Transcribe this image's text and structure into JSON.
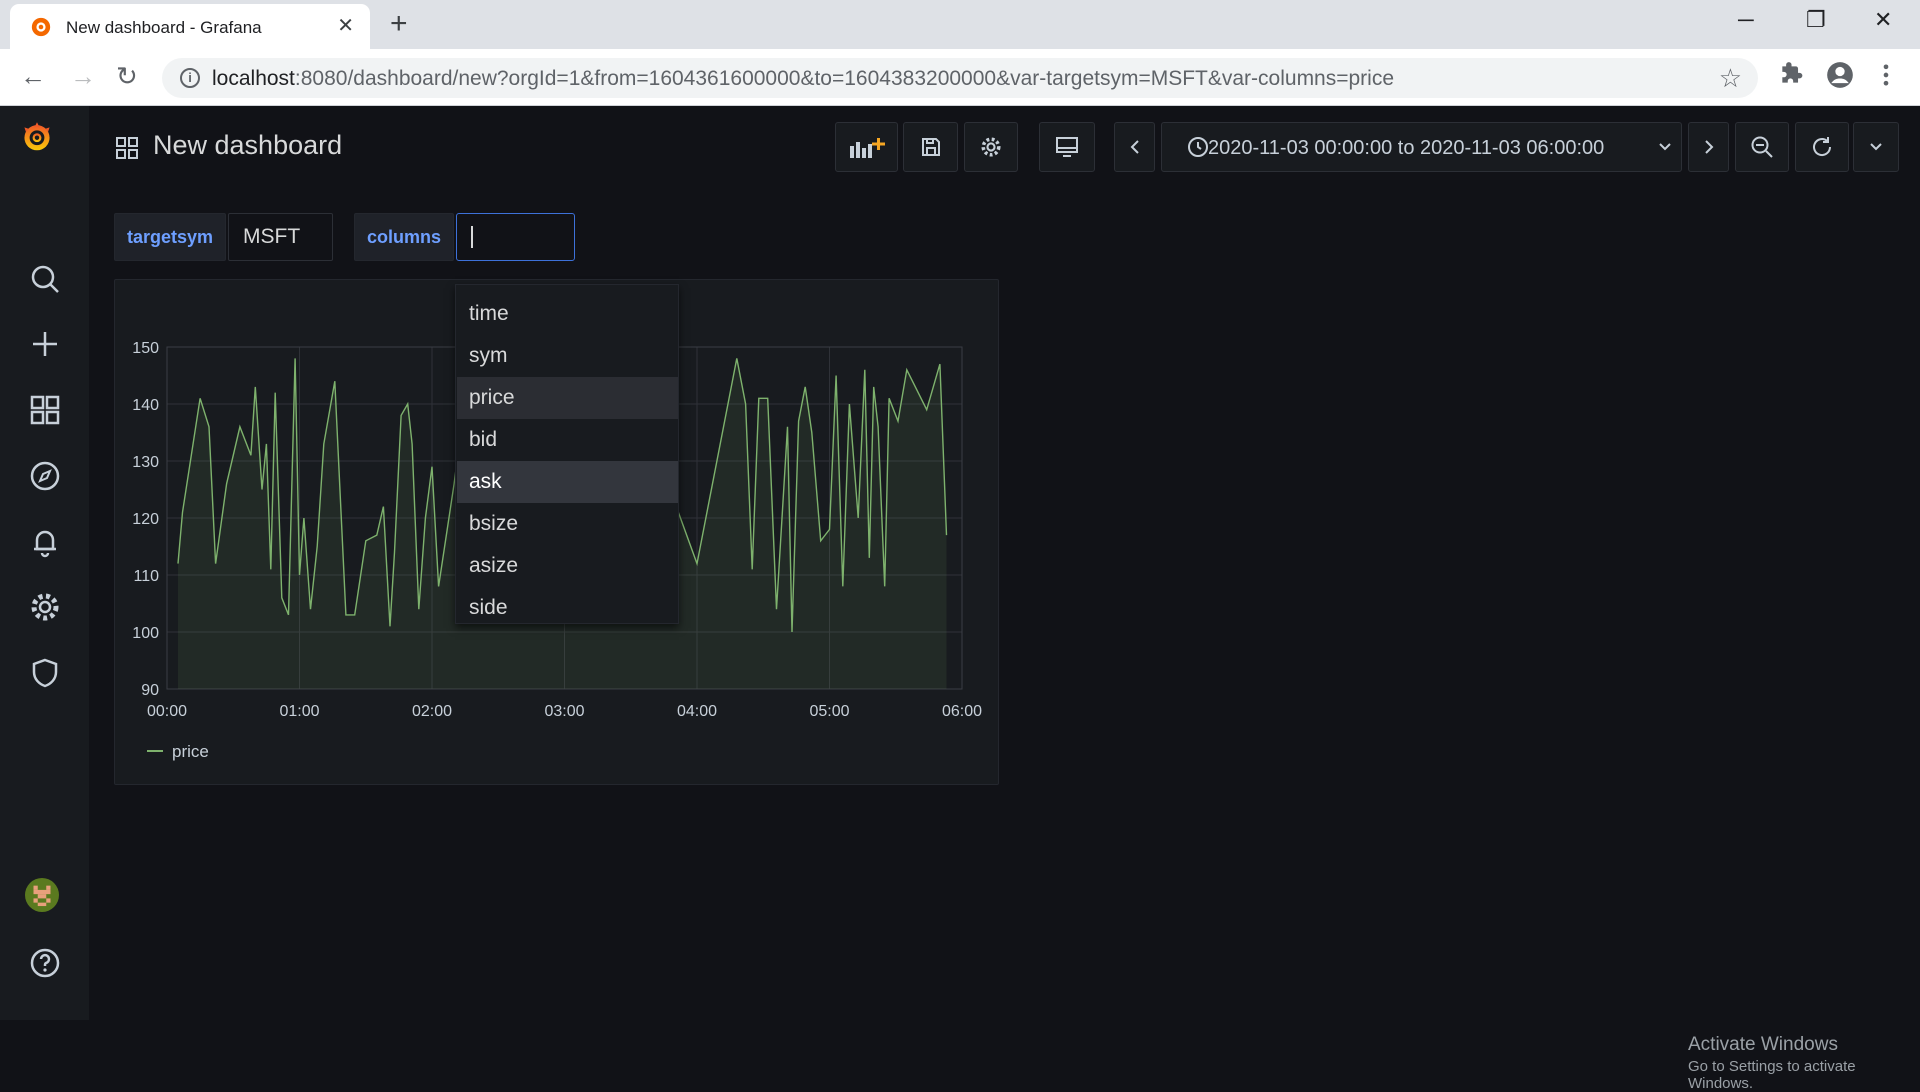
{
  "browser": {
    "tab_title": "New dashboard - Grafana",
    "url_host": "localhost",
    "url_rest": ":8080/dashboard/new?orgId=1&from=1604361600000&to=1604383200000&var-targetsym=MSFT&var-columns=price"
  },
  "dashboard": {
    "title": "New dashboard",
    "time_range": "2020-11-03 00:00:00 to 2020-11-03 06:00:00"
  },
  "variables": {
    "targetsym_label": "targetsym",
    "targetsym_value": "MSFT",
    "columns_label": "columns",
    "columns_input": ""
  },
  "dropdown": {
    "options": [
      "time",
      "sym",
      "price",
      "bid",
      "ask",
      "bsize",
      "asize",
      "side"
    ],
    "selected": "price",
    "highlighted": "ask"
  },
  "colors": {
    "series": "#7eb26d",
    "accent": "#3d71d9",
    "label": "#6e9fff"
  },
  "chart_data": {
    "type": "area",
    "title": "",
    "xlabel": "",
    "ylabel": "",
    "ylim": [
      90,
      150
    ],
    "yticks": [
      90,
      100,
      110,
      120,
      130,
      140,
      150
    ],
    "xticks": [
      "00:00",
      "01:00",
      "02:00",
      "03:00",
      "04:00",
      "05:00",
      "06:00"
    ],
    "xlim_minutes": [
      0,
      360
    ],
    "grid": true,
    "legend": "bottom-left",
    "series": [
      {
        "name": "price",
        "x_minutes": [
          5,
          7,
          15,
          19,
          22,
          27,
          33,
          38,
          40,
          43,
          45,
          47,
          49,
          52,
          55,
          58,
          60,
          62,
          65,
          68,
          71,
          76,
          81,
          85,
          90,
          95,
          98,
          101,
          103,
          106,
          109,
          111,
          114,
          117,
          120,
          123,
          130,
          137,
          142,
          155,
          182,
          210,
          240,
          258,
          262,
          265,
          268,
          272,
          276,
          281,
          283,
          286,
          289,
          292,
          296,
          300,
          303,
          306,
          309,
          313,
          316,
          318,
          320,
          322,
          325,
          327,
          331,
          335,
          344,
          350,
          353
        ],
        "y": [
          112,
          121,
          141,
          136,
          112,
          126,
          136,
          131,
          143,
          125,
          133,
          111,
          142,
          106,
          103,
          148,
          110,
          120,
          104,
          115,
          133,
          144,
          103,
          103,
          116,
          117,
          122,
          101,
          114,
          138,
          140,
          133,
          104,
          120,
          129,
          108,
          126,
          147,
          139,
          104,
          128,
          144,
          112,
          148,
          140,
          111,
          141,
          141,
          104,
          136,
          100,
          137,
          143,
          135,
          116,
          118,
          145,
          108,
          140,
          120,
          146,
          113,
          143,
          136,
          108,
          141,
          137,
          146,
          139,
          147,
          117
        ]
      }
    ]
  },
  "watermark": {
    "line1": "Activate Windows",
    "line2": "Go to Settings to activate Windows."
  }
}
